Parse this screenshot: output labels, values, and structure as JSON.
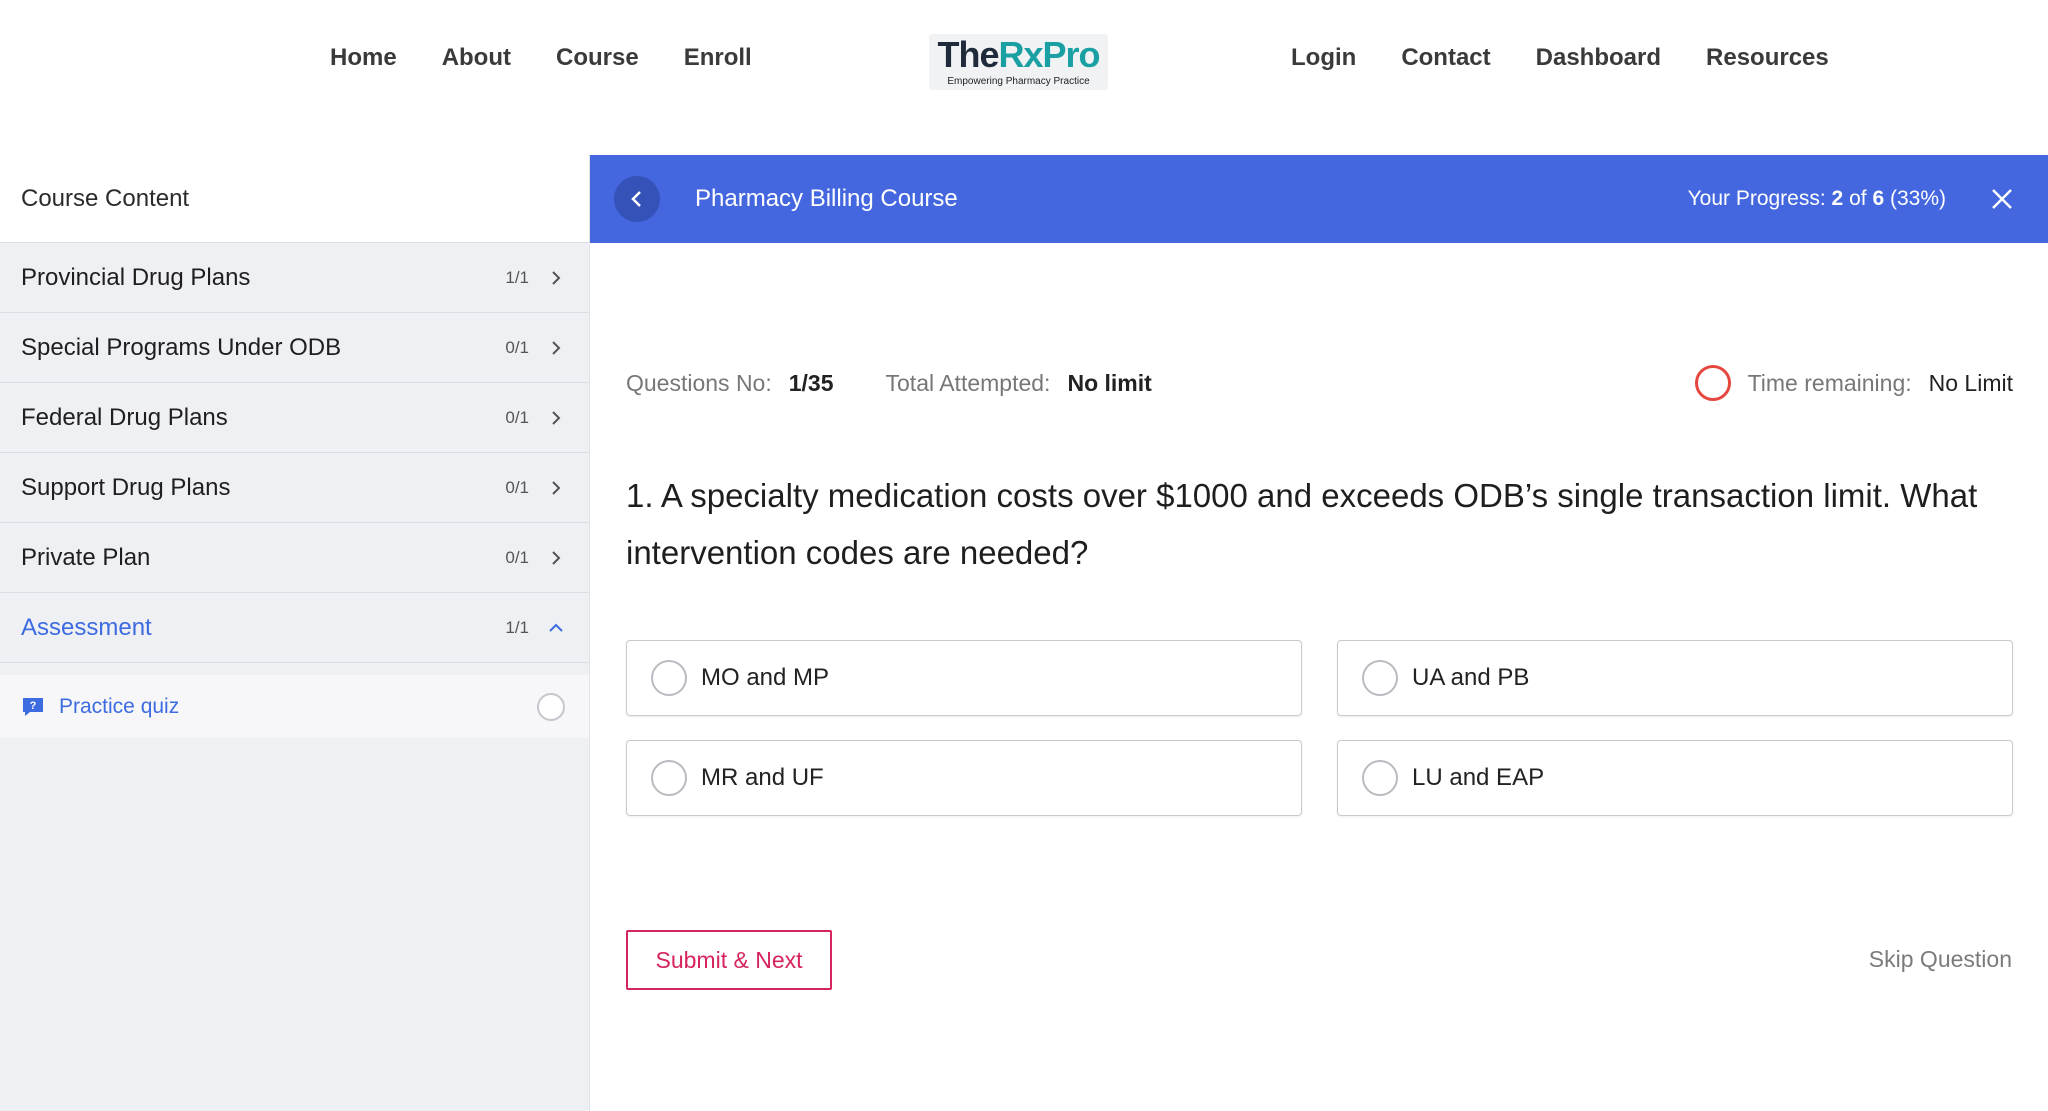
{
  "nav": {
    "left": [
      "Home",
      "About",
      "Course",
      "Enroll"
    ],
    "right": [
      "Login",
      "Contact",
      "Dashboard",
      "Resources"
    ],
    "logo_the": "The",
    "logo_rx": "RxPro",
    "logo_tagline": "Empowering Pharmacy Practice"
  },
  "sidebar": {
    "header": "Course Content",
    "sections": [
      {
        "label": "Provincial Drug Plans",
        "count": "1/1"
      },
      {
        "label": "Special Programs Under ODB",
        "count": "0/1"
      },
      {
        "label": "Federal Drug Plans",
        "count": "0/1"
      },
      {
        "label": "Support Drug Plans",
        "count": "0/1"
      },
      {
        "label": "Private Plan",
        "count": "0/1"
      },
      {
        "label": "Assessment",
        "count": "1/1"
      }
    ],
    "lesson": {
      "label": "Practice quiz"
    }
  },
  "course_bar": {
    "title": "Pharmacy Billing Course",
    "progress_label": "Your Progress:",
    "progress_current": "2",
    "progress_of": "of",
    "progress_total": "6",
    "progress_percent": "(33%)"
  },
  "quiz": {
    "question_no_label": "Questions No:",
    "question_no_value": "1/35",
    "attempted_label": "Total Attempted:",
    "attempted_value": "No limit",
    "time_label": "Time remaining:",
    "time_value": "No Limit",
    "question_text": "1. A specialty medication costs over $1000 and exceeds ODB’s single transaction limit. What intervention codes are needed?",
    "options": [
      "MO and MP",
      "UA and PB",
      "MR and UF",
      "LU and EAP"
    ],
    "submit_label": "Submit & Next",
    "skip_label": "Skip Question"
  },
  "colors": {
    "primary": "#4467e0",
    "link_active": "#3d6be0",
    "submit": "#d6245c",
    "timer": "#e5473f",
    "logo_accent": "#1aa0a3"
  },
  "icons": {
    "back": "chevron-left-icon",
    "close": "close-icon",
    "section_toggle": "chevron-right-icon",
    "expanded_toggle": "chevron-up-icon",
    "lesson": "quiz-icon",
    "timer": "timer-circle-icon"
  }
}
